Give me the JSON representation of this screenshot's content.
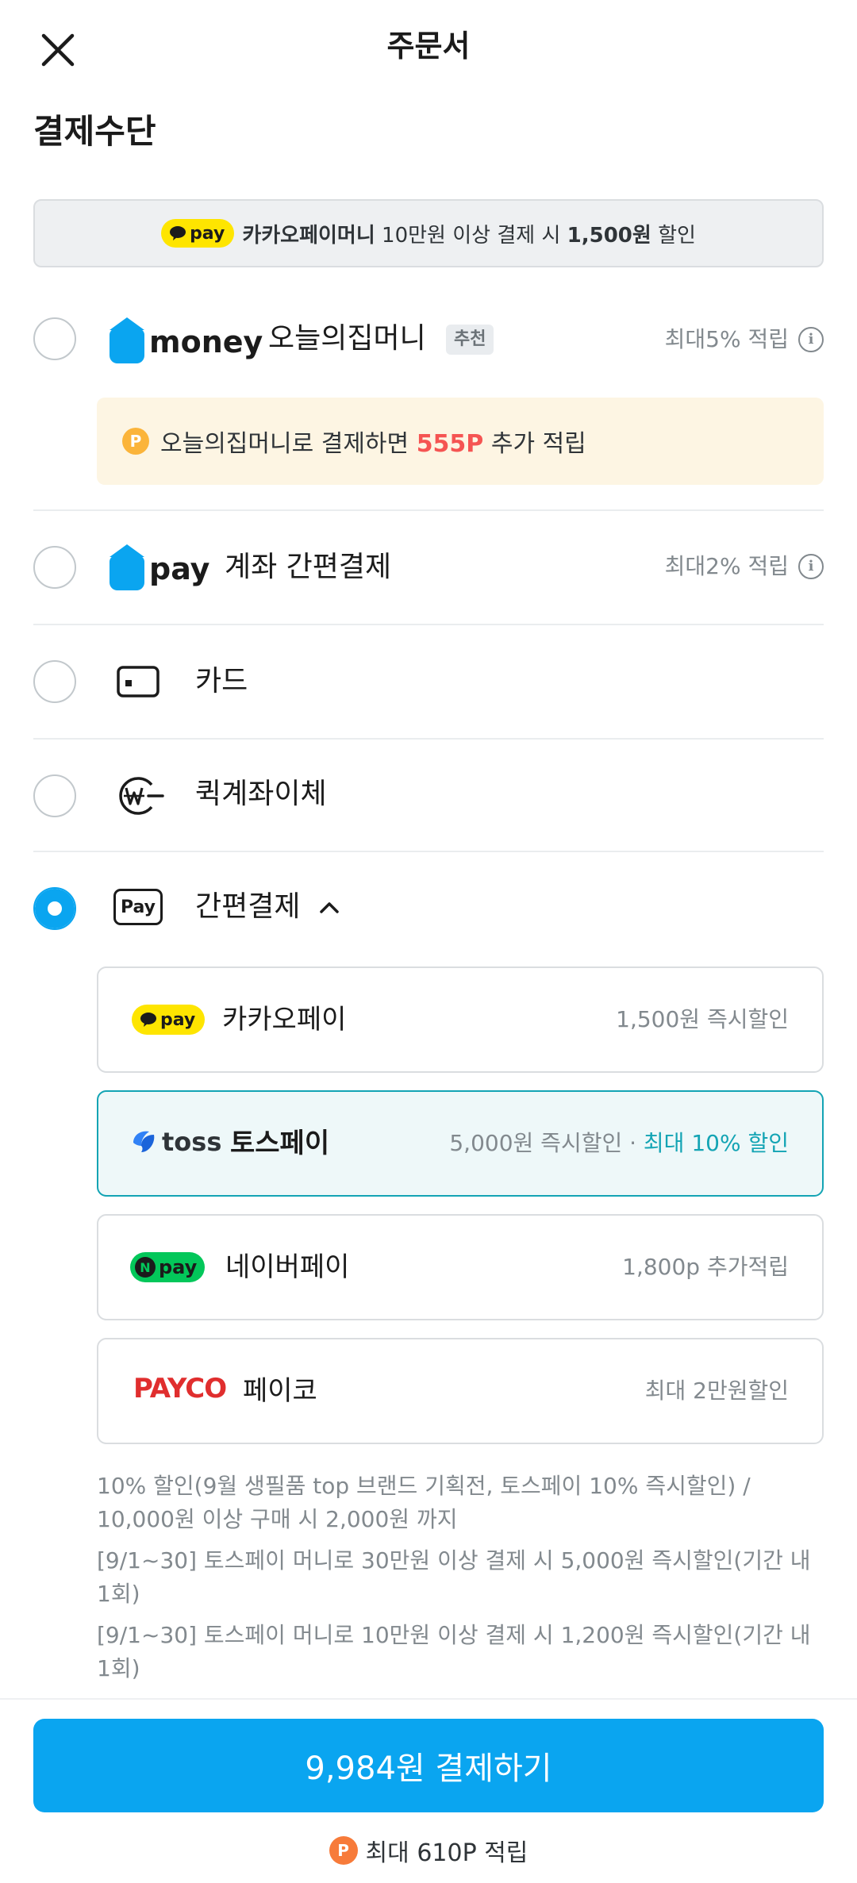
{
  "header": {
    "title": "주문서"
  },
  "section_title": "결제수단",
  "promo": {
    "pill": "pay",
    "part1": "카카오페이머니",
    "part2": "10만원 이상 결제 시",
    "part3": "1,500원",
    "part4": "할인"
  },
  "methods": {
    "money": {
      "logo_text": "money",
      "label": "오늘의집머니",
      "badge": "추천",
      "right": "최대5% 적립",
      "note_prefix": "오늘의집머니로 결제하면",
      "note_points": "555P",
      "note_suffix": "추가 적립",
      "coin": "P"
    },
    "pay": {
      "logo_text": "pay",
      "label": "계좌 간편결제",
      "right": "최대2% 적립"
    },
    "card": {
      "label": "카드"
    },
    "quick": {
      "label": "퀵계좌이체"
    },
    "easy": {
      "icon_text": "Pay",
      "label": "간편결제"
    }
  },
  "easy_pay_options": [
    {
      "logo": "pay",
      "label": "카카오페이",
      "right": "1,500원 즉시할인"
    },
    {
      "logo": "toss",
      "label": "토스페이",
      "right": "5,000원 즉시할인 · ",
      "right_highlight": "최대 10% 할인"
    },
    {
      "logo": "pay",
      "logo_prefix": "N",
      "label": "네이버페이",
      "right": "1,800p 추가적립"
    },
    {
      "logo": "PAYCO",
      "label": "페이코",
      "right": "최대 2만원할인"
    }
  ],
  "notes": [
    "10% 할인(9월 생필품 top 브랜드 기획전, 토스페이 10% 즉시할인) / 10,000원 이상 구매 시 2,000원 까지",
    "[9/1~30] 토스페이 머니로 30만원 이상 결제 시 5,000원 즉시할인(기간 내 1회)",
    "[9/1~30] 토스페이 머니로 10만원 이상 결제 시 1,200원 즉시할인(기간 내 1회)"
  ],
  "bottom": {
    "pay_button": "9,984원 결제하기",
    "max_point": "최대 610P 적립",
    "coin": "P"
  },
  "colors": {
    "primary": "#0aa5f0",
    "teal": "#13a4b4",
    "kakao_yellow": "#fee500",
    "naver_green": "#03c75a",
    "payco_red": "#e02e2e",
    "highlight_red": "#f55452"
  }
}
